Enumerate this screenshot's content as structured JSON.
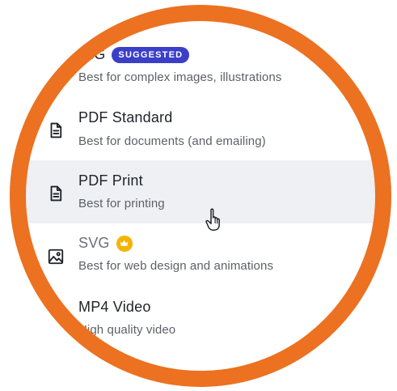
{
  "menu": {
    "items": [
      {
        "title": "NG",
        "badge": "SUGGESTED",
        "description": "Best for complex images, illustrations",
        "icon": "image-icon",
        "state": "normal"
      },
      {
        "title": "PDF Standard",
        "description": "Best for documents (and emailing)",
        "icon": "document-icon",
        "state": "normal"
      },
      {
        "title": "PDF Print",
        "description": "Best for printing",
        "icon": "document-icon",
        "state": "hovered"
      },
      {
        "title": "SVG",
        "premium_icon": "crown-icon",
        "description": "Best for web design and animations",
        "icon": "image-icon",
        "state": "muted"
      },
      {
        "title": "MP4 Video",
        "description": "High quality video",
        "icon": "video-icon",
        "state": "normal"
      }
    ]
  },
  "colors": {
    "ring": "#ec7120",
    "badge": "#3b3fc8",
    "hover_background": "#eef0f3",
    "crown": "#f5b400"
  },
  "cursor": "pointer-hand-icon"
}
